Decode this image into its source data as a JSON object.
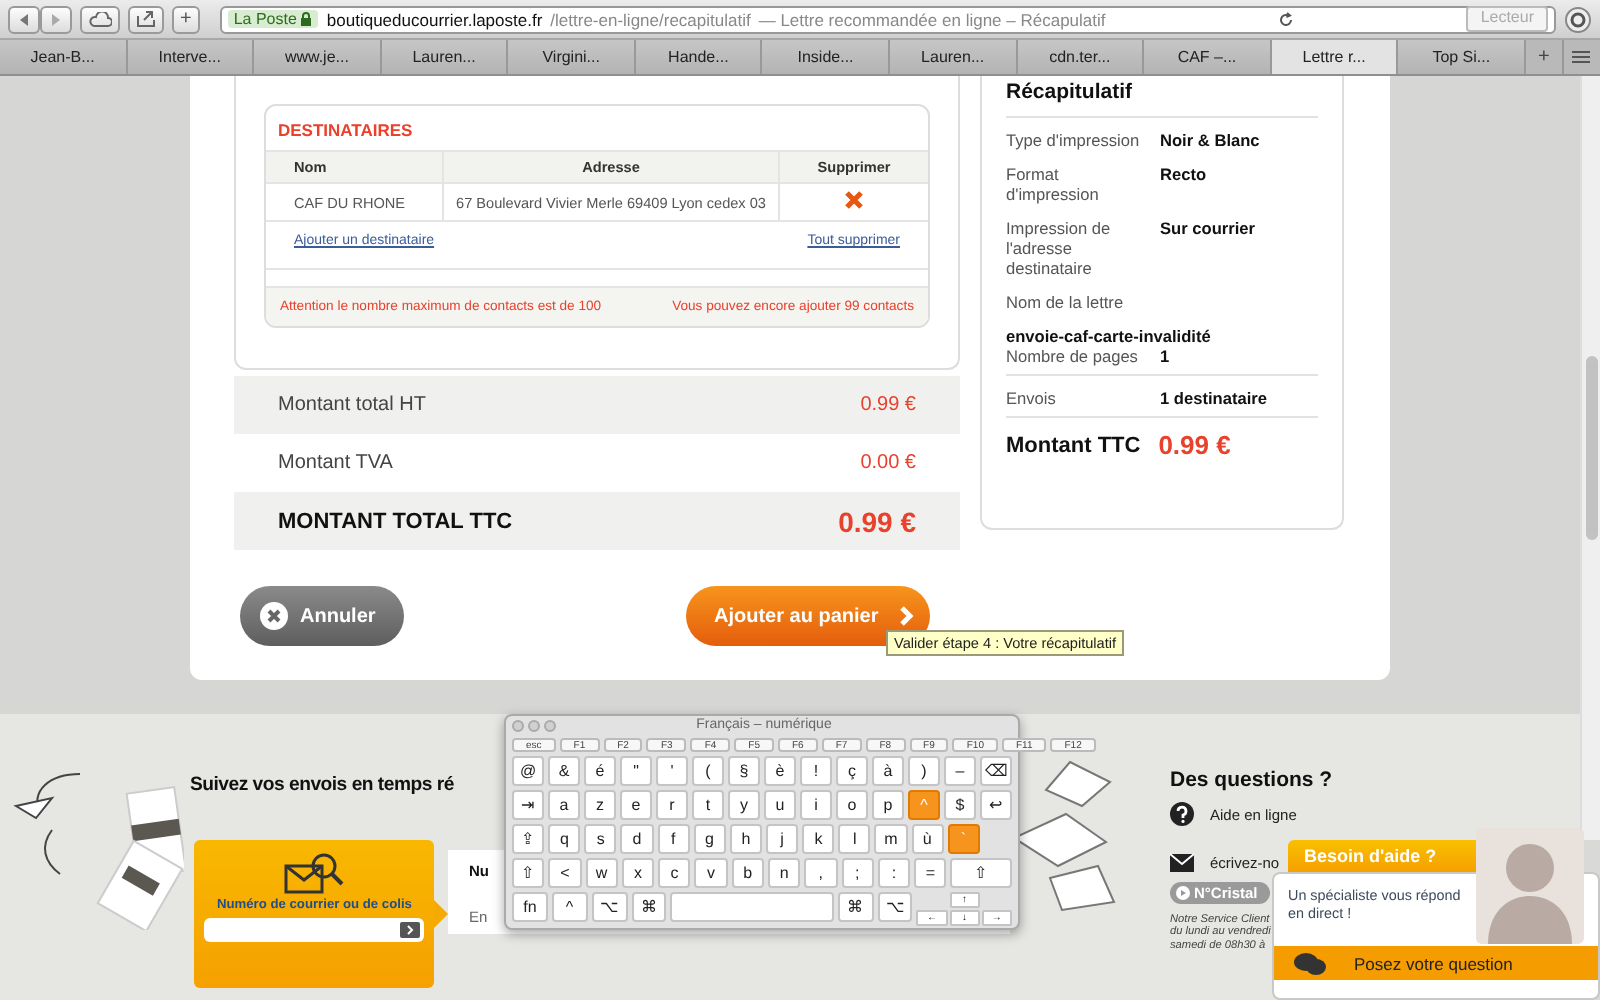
{
  "browser": {
    "address": {
      "badge": "La Poste",
      "host": "boutiqueducourrier.laposte.fr",
      "path": "/lettre-en-ligne/recapitulatif",
      "page_title": "— Lettre recommandée en ligne – Récapulatif"
    },
    "new_tab_button": "+",
    "reader_button": "Lecteur",
    "tabs": [
      {
        "label": "Jean-B...",
        "selected": false
      },
      {
        "label": "Interve...",
        "selected": false
      },
      {
        "label": "www.je...",
        "selected": false
      },
      {
        "label": "Lauren...",
        "selected": false
      },
      {
        "label": "Virgini...",
        "selected": false
      },
      {
        "label": "Hande...",
        "selected": false
      },
      {
        "label": "Inside...",
        "selected": false
      },
      {
        "label": "Lauren...",
        "selected": false
      },
      {
        "label": "cdn.ter...",
        "selected": false
      },
      {
        "label": "CAF –...",
        "selected": false
      },
      {
        "label": "Lettre r...",
        "selected": true
      },
      {
        "label": "Top Si...",
        "selected": false
      }
    ],
    "tab_add": "+"
  },
  "recipients": {
    "title": "DESTINATAIRES",
    "columns": [
      "Nom",
      "Adresse",
      "Supprimer"
    ],
    "rows": [
      {
        "name": "CAF DU RHONE",
        "address": "67 Boulevard Vivier Merle 69409 Lyon cedex 03"
      }
    ],
    "add_link": "Ajouter un destinataire",
    "clear_link": "Tout supprimer",
    "warning_max": "Attention le nombre maximum de contacts est de 100",
    "warning_remaining": "Vous pouvez encore ajouter 99 contacts"
  },
  "totals": [
    {
      "kind": "line",
      "label": "Montant total HT",
      "amount": "0.99 €"
    },
    {
      "kind": "line",
      "label": "Montant TVA",
      "amount": "0.00 €"
    },
    {
      "kind": "grand",
      "label": "MONTANT TOTAL TTC",
      "amount": "0.99 €"
    }
  ],
  "summary": {
    "title": "Récapitulatif",
    "sections": [
      [
        {
          "kind": "pair",
          "label": "Type d'impression",
          "value": "Noir & Blanc"
        },
        {
          "kind": "pair",
          "label": "Format d'impression",
          "value": "Recto"
        },
        {
          "kind": "pair",
          "label": "Impression de l'adresse destinataire",
          "value": "Sur courrier"
        },
        {
          "kind": "label",
          "label": "Nom de la lettre"
        },
        {
          "kind": "strong",
          "value": "envoie-caf-carte-invalidité"
        },
        {
          "kind": "pair",
          "label": "Nombre de pages",
          "value": "1"
        }
      ],
      [
        {
          "kind": "pair",
          "label": "Envois",
          "value": "1 destinataire"
        }
      ]
    ],
    "total_label": "Montant TTC",
    "total_amount": "0.99 €"
  },
  "actions": {
    "cancel": "Annuler",
    "add_to_cart": "Ajouter au panier",
    "tooltip": "Valider étape 4 : Votre récapitulatif"
  },
  "tracking": {
    "title": "Suivez vos envois en temps ré",
    "field_label": "Numéro de courrier ou de colis",
    "panel_text_1": "Nu",
    "panel_text_2": "En"
  },
  "keyboard": {
    "title": "Français – numérique",
    "function_keys": [
      "esc",
      "F1",
      "F2",
      "F3",
      "F4",
      "F5",
      "F6",
      "F7",
      "F8",
      "F9",
      "F10",
      "F11",
      "F12"
    ],
    "rows": [
      [
        {
          "label": "@",
          "kind": "char",
          "on": false
        },
        {
          "label": "&",
          "kind": "char",
          "on": false
        },
        {
          "label": "é",
          "kind": "char",
          "on": false
        },
        {
          "label": "\"",
          "kind": "char",
          "on": false
        },
        {
          "label": "'",
          "kind": "char",
          "on": false
        },
        {
          "label": "(",
          "kind": "char",
          "on": false
        },
        {
          "label": "§",
          "kind": "char",
          "on": false
        },
        {
          "label": "è",
          "kind": "char",
          "on": false
        },
        {
          "label": "!",
          "kind": "char",
          "on": false
        },
        {
          "label": "ç",
          "kind": "char",
          "on": false
        },
        {
          "label": "à",
          "kind": "char",
          "on": false
        },
        {
          "label": ")",
          "kind": "char",
          "on": false
        },
        {
          "label": "–",
          "kind": "char",
          "on": false
        },
        {
          "label": "⌫",
          "kind": "char",
          "on": false
        }
      ],
      [
        {
          "label": "⇥",
          "kind": "char",
          "on": false
        },
        {
          "label": "a",
          "kind": "char",
          "on": false
        },
        {
          "label": "z",
          "kind": "char",
          "on": false
        },
        {
          "label": "e",
          "kind": "char",
          "on": false
        },
        {
          "label": "r",
          "kind": "char",
          "on": false
        },
        {
          "label": "t",
          "kind": "char",
          "on": false
        },
        {
          "label": "y",
          "kind": "char",
          "on": false
        },
        {
          "label": "u",
          "kind": "char",
          "on": false
        },
        {
          "label": "i",
          "kind": "char",
          "on": false
        },
        {
          "label": "o",
          "kind": "char",
          "on": false
        },
        {
          "label": "p",
          "kind": "char",
          "on": false
        },
        {
          "label": "^",
          "kind": "char",
          "on": true
        },
        {
          "label": "$",
          "kind": "char",
          "on": false
        },
        {
          "label": "↩",
          "kind": "char",
          "on": false
        }
      ],
      [
        {
          "label": "⇪",
          "kind": "char",
          "on": false
        },
        {
          "label": "q",
          "kind": "char",
          "on": false
        },
        {
          "label": "s",
          "kind": "char",
          "on": false
        },
        {
          "label": "d",
          "kind": "char",
          "on": false
        },
        {
          "label": "f",
          "kind": "char",
          "on": false
        },
        {
          "label": "g",
          "kind": "char",
          "on": false
        },
        {
          "label": "h",
          "kind": "char",
          "on": false
        },
        {
          "label": "j",
          "kind": "char",
          "on": false
        },
        {
          "label": "k",
          "kind": "char",
          "on": false
        },
        {
          "label": "l",
          "kind": "char",
          "on": false
        },
        {
          "label": "m",
          "kind": "char",
          "on": false
        },
        {
          "label": "ù",
          "kind": "char",
          "on": false
        },
        {
          "label": "`",
          "kind": "char",
          "on": true
        }
      ],
      [
        {
          "label": "⇧",
          "kind": "char",
          "on": false
        },
        {
          "label": "<",
          "kind": "char",
          "on": false
        },
        {
          "label": "w",
          "kind": "char",
          "on": false
        },
        {
          "label": "x",
          "kind": "char",
          "on": false
        },
        {
          "label": "c",
          "kind": "char",
          "on": false
        },
        {
          "label": "v",
          "kind": "char",
          "on": false
        },
        {
          "label": "b",
          "kind": "char",
          "on": false
        },
        {
          "label": "n",
          "kind": "char",
          "on": false
        },
        {
          "label": ",",
          "kind": "char",
          "on": false
        },
        {
          "label": ";",
          "kind": "char",
          "on": false
        },
        {
          "label": ":",
          "kind": "char",
          "on": false
        },
        {
          "label": "=",
          "kind": "char",
          "on": false
        },
        {
          "label": "⇧",
          "kind": "wide",
          "on": false
        }
      ]
    ],
    "bottom_row": {
      "left_keys": [
        {
          "label": "fn",
          "on": false
        },
        {
          "label": "^",
          "on": false
        },
        {
          "label": "⌥",
          "on": false
        },
        {
          "label": "⌘",
          "on": false
        }
      ],
      "right_keys": [
        {
          "label": "⌘",
          "on": false
        },
        {
          "label": "⌥",
          "on": false
        }
      ]
    },
    "arrows": [
      "↑",
      "←",
      "↓",
      "→"
    ]
  },
  "questions": {
    "title": "Des questions ?",
    "help_link": "Aide en ligne",
    "write_link": "écrivez-no",
    "badge": "N°Cristal",
    "notes": [
      "Notre Service Client",
      "du lundi au vendredi",
      "samedi de 08h30 à"
    ]
  },
  "help_widget": {
    "title": "Besoin d'aide ?",
    "text": "Un spécialiste vous répond en direct !",
    "button": "Posez votre question"
  }
}
